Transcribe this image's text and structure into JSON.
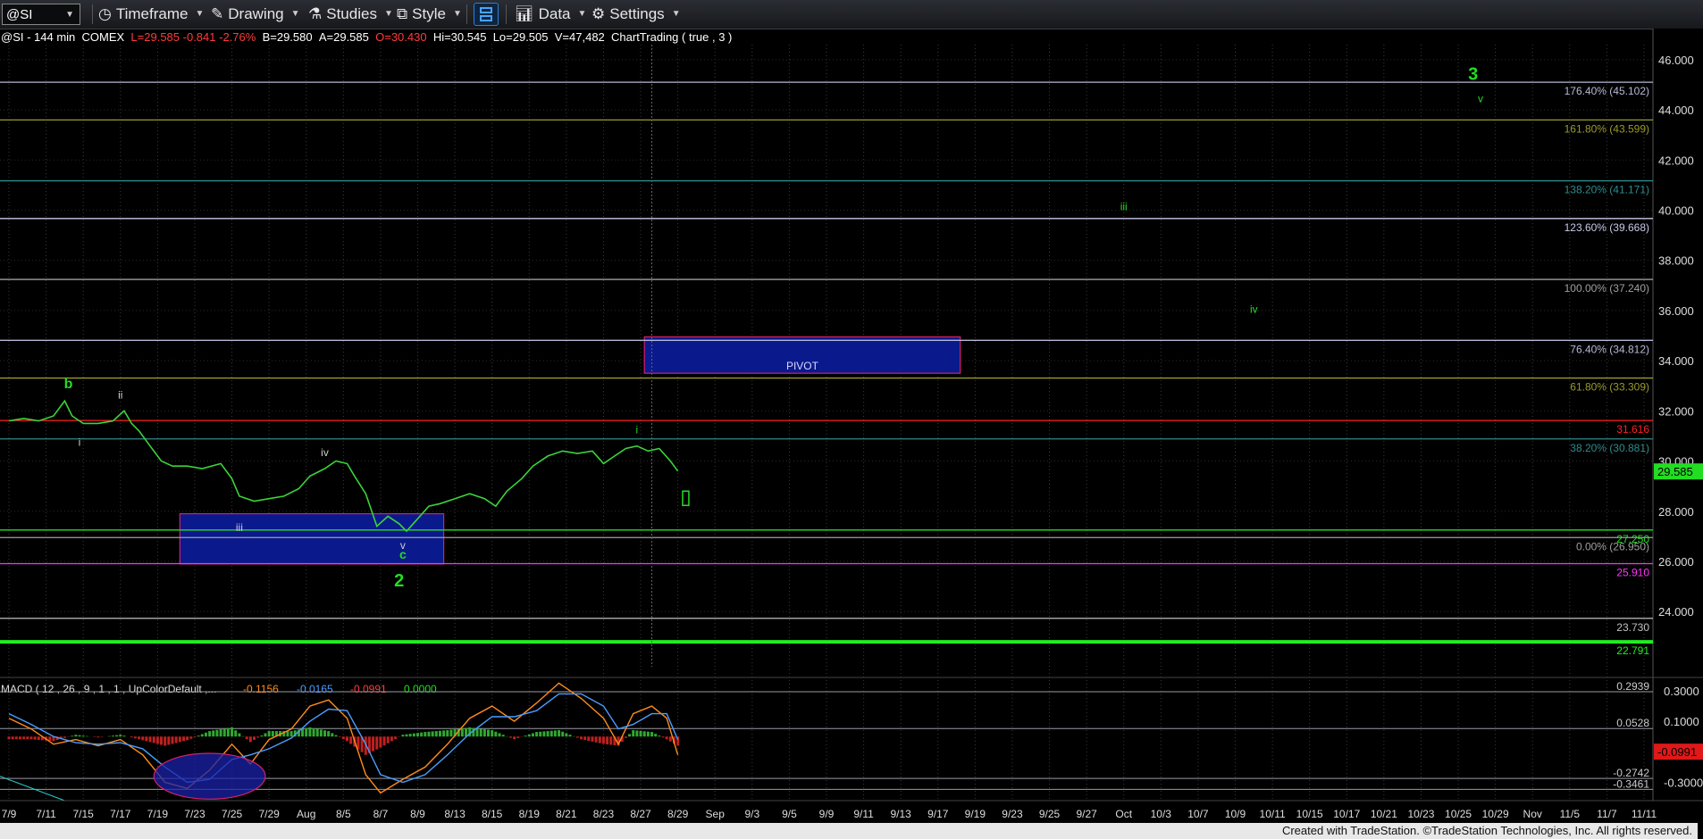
{
  "toolbar": {
    "symbol": "@SI",
    "items": [
      {
        "label": "Timeframe",
        "icon": "clock-icon"
      },
      {
        "label": "Drawing",
        "icon": "pencil-icon"
      },
      {
        "label": "Studies",
        "icon": "flask-icon"
      },
      {
        "label": "Style",
        "icon": "style-icon"
      },
      {
        "label": "Data",
        "icon": "bar-chart-icon"
      },
      {
        "label": "Settings",
        "icon": "gear-icon"
      }
    ]
  },
  "info": {
    "symbol": "@SI - 144 min",
    "exchange": "COMEX",
    "last": "L=29.585",
    "change": "-0.841",
    "pct": "-2.76%",
    "bid": "B=29.580",
    "ask": "A=29.585",
    "open": "O=30.430",
    "high": "Hi=30.545",
    "low": "Lo=29.505",
    "volume": "V=47,482",
    "study": "ChartTrading ( true , 3 )"
  },
  "credit": "Created with TradeStation. ©TradeStation Technologies, Inc. All rights reserved.",
  "chart_data": {
    "type": "line",
    "price_axis": {
      "ylim": [
        21.8,
        46.6
      ],
      "ticks": [
        {
          "v": 46,
          "label": "46.000"
        },
        {
          "v": 44,
          "label": "44.000"
        },
        {
          "v": 42,
          "label": "42.000"
        },
        {
          "v": 40,
          "label": "40.000"
        },
        {
          "v": 38,
          "label": "38.000"
        },
        {
          "v": 36,
          "label": "36.000"
        },
        {
          "v": 34,
          "label": "34.000"
        },
        {
          "v": 32,
          "label": "32.000"
        },
        {
          "v": 30,
          "label": "30.000"
        },
        {
          "v": 28,
          "label": "28.000"
        },
        {
          "v": 26,
          "label": "26.000"
        },
        {
          "v": 24,
          "label": "24.000"
        }
      ],
      "last_price": {
        "label": "29.585",
        "v": 29.585,
        "color": "#22dd22"
      }
    },
    "x_axis": {
      "labels": [
        "7/9",
        "7/11",
        "7/15",
        "7/17",
        "7/19",
        "7/23",
        "7/25",
        "7/29",
        "Aug",
        "8/5",
        "8/7",
        "8/9",
        "8/13",
        "8/15",
        "8/19",
        "8/21",
        "8/23",
        "8/27",
        "8/29",
        "Sep",
        "9/3",
        "9/5",
        "9/9",
        "9/11",
        "9/13",
        "9/17",
        "9/19",
        "9/23",
        "9/25",
        "9/27",
        "Oct",
        "10/3",
        "10/7",
        "10/9",
        "10/11",
        "10/15",
        "10/17",
        "10/21",
        "10/23",
        "10/25",
        "10/29",
        "Nov",
        "11/5",
        "11/7",
        "11/11"
      ],
      "last_bar_index": 18
    },
    "levels": [
      {
        "label": "176.40% (45.102)",
        "v": 45.102,
        "color": "#b8b8d8",
        "style": "solid"
      },
      {
        "label": "161.80% (43.599)",
        "v": 43.599,
        "color": "#9a9a2a",
        "style": "solid"
      },
      {
        "label": "138.20% (41.171)",
        "v": 41.171,
        "color": "#2e8b8b",
        "style": "solid"
      },
      {
        "label": "123.60% (39.668)",
        "v": 39.668,
        "color": "#c8c8e8",
        "style": "solid"
      },
      {
        "label": "100.00% (37.240)",
        "v": 37.24,
        "color": "#a0a0a0",
        "style": "solid"
      },
      {
        "label": "76.40% (34.812)",
        "v": 34.812,
        "color": "#b8b8d8",
        "style": "solid"
      },
      {
        "label": "61.80% (33.309)",
        "v": 33.309,
        "color": "#9a9a2a",
        "style": "solid"
      },
      {
        "label": "31.616",
        "v": 31.616,
        "color": "#ff2020",
        "style": "solid"
      },
      {
        "label": "38.20% (30.881)",
        "v": 30.881,
        "color": "#2e8b8b",
        "style": "solid"
      },
      {
        "label": "27.250",
        "v": 27.25,
        "color": "#22dd22",
        "style": "solid"
      },
      {
        "label": "0.00% (26.950)",
        "v": 26.95,
        "color": "#a0a0a0",
        "style": "solid"
      },
      {
        "label": "25.910",
        "v": 25.91,
        "color": "#ff33ff",
        "style": "solid"
      },
      {
        "label": "23.730",
        "v": 23.73,
        "color": "#c0c0c0",
        "style": "solid"
      },
      {
        "label": "22.791",
        "v": 22.791,
        "color": "#22ee22",
        "style": "thick"
      }
    ],
    "boxes": [
      {
        "label": "PIVOT",
        "x0": 17.1,
        "x1": 25.6,
        "y0": 33.5,
        "y1": 34.95
      },
      {
        "label": "",
        "x0": 4.6,
        "x1": 11.7,
        "y0": 25.9,
        "y1": 27.9
      }
    ],
    "wave_labels": [
      {
        "text": "b",
        "x": 1.6,
        "y": 32.9,
        "color": "#22dd22",
        "size": 16
      },
      {
        "text": "i",
        "x": 1.9,
        "y": 30.6,
        "color": "#cccccc",
        "size": 12
      },
      {
        "text": "ii",
        "x": 3.0,
        "y": 32.5,
        "color": "#cccccc",
        "size": 12
      },
      {
        "text": "iii",
        "x": 6.2,
        "y": 27.2,
        "color": "#cccccc",
        "size": 12
      },
      {
        "text": "iv",
        "x": 8.5,
        "y": 30.2,
        "color": "#cccccc",
        "size": 12
      },
      {
        "text": "v",
        "x": 10.6,
        "y": 26.5,
        "color": "#cccccc",
        "size": 12
      },
      {
        "text": "c",
        "x": 10.6,
        "y": 26.1,
        "color": "#22dd22",
        "size": 14
      },
      {
        "text": "2",
        "x": 10.5,
        "y": 25.0,
        "color": "#22dd22",
        "size": 20
      },
      {
        "text": "i",
        "x": 16.9,
        "y": 31.1,
        "color": "#22dd22",
        "size": 12
      },
      {
        "text": "iii",
        "x": 30.0,
        "y": 40.0,
        "color": "#22dd22",
        "size": 12
      },
      {
        "text": "iv",
        "x": 33.5,
        "y": 35.9,
        "color": "#22dd22",
        "size": 12
      },
      {
        "text": "3",
        "x": 39.4,
        "y": 45.2,
        "color": "#22dd22",
        "size": 20
      },
      {
        "text": "v",
        "x": 39.6,
        "y": 44.3,
        "color": "#22dd22",
        "size": 12
      }
    ],
    "price_series": {
      "name": "@SI",
      "points": [
        [
          0,
          31.6
        ],
        [
          0.4,
          31.7
        ],
        [
          0.8,
          31.6
        ],
        [
          1.2,
          31.8
        ],
        [
          1.5,
          32.4
        ],
        [
          1.7,
          31.8
        ],
        [
          2.0,
          31.5
        ],
        [
          2.4,
          31.5
        ],
        [
          2.8,
          31.6
        ],
        [
          3.1,
          32.0
        ],
        [
          3.3,
          31.5
        ],
        [
          3.5,
          31.2
        ],
        [
          3.8,
          30.6
        ],
        [
          4.1,
          30.0
        ],
        [
          4.4,
          29.8
        ],
        [
          4.8,
          29.8
        ],
        [
          5.2,
          29.7
        ],
        [
          5.7,
          29.9
        ],
        [
          6.0,
          29.3
        ],
        [
          6.2,
          28.6
        ],
        [
          6.6,
          28.4
        ],
        [
          7.0,
          28.5
        ],
        [
          7.4,
          28.6
        ],
        [
          7.8,
          28.9
        ],
        [
          8.1,
          29.4
        ],
        [
          8.5,
          29.7
        ],
        [
          8.8,
          30.0
        ],
        [
          9.1,
          29.9
        ],
        [
          9.3,
          29.4
        ],
        [
          9.6,
          28.7
        ],
        [
          9.9,
          27.4
        ],
        [
          10.2,
          27.8
        ],
        [
          10.5,
          27.5
        ],
        [
          10.7,
          27.2
        ],
        [
          11.0,
          27.7
        ],
        [
          11.3,
          28.2
        ],
        [
          11.6,
          28.3
        ],
        [
          12.0,
          28.5
        ],
        [
          12.4,
          28.7
        ],
        [
          12.8,
          28.5
        ],
        [
          13.1,
          28.2
        ],
        [
          13.4,
          28.8
        ],
        [
          13.8,
          29.3
        ],
        [
          14.1,
          29.8
        ],
        [
          14.5,
          30.2
        ],
        [
          14.9,
          30.4
        ],
        [
          15.3,
          30.3
        ],
        [
          15.7,
          30.4
        ],
        [
          16.0,
          29.9
        ],
        [
          16.3,
          30.2
        ],
        [
          16.6,
          30.5
        ],
        [
          16.9,
          30.6
        ],
        [
          17.2,
          30.4
        ],
        [
          17.5,
          30.5
        ],
        [
          17.8,
          30.0
        ],
        [
          18.0,
          29.6
        ]
      ]
    },
    "macd": {
      "label": "MACD ( 12 , 26 , 9 , 1 , 1 , UpColorDefault ,...",
      "values": [
        "-0.1156",
        "-0.0165",
        "-0.0991",
        "0.0000"
      ],
      "value_colors": [
        "#ff8c1a",
        "#4a9eff",
        "#ff3b3b",
        "#22dd22"
      ],
      "ylim": [
        -0.42,
        0.37
      ],
      "ticks": [
        {
          "v": 0.3,
          "label": "0.3000"
        },
        {
          "v": 0.1,
          "label": "0.1000"
        },
        {
          "v": -0.3,
          "label": "-0.3000"
        }
      ],
      "levels": [
        {
          "v": 0.2939,
          "label": "0.2939"
        },
        {
          "v": 0.0528,
          "label": "0.0528"
        },
        {
          "v": -0.2742,
          "label": "-0.2742"
        },
        {
          "v": -0.3461,
          "label": "-0.3461"
        }
      ],
      "current": {
        "v": -0.0991,
        "label": "-0.0991"
      },
      "macd_line": [
        [
          0,
          0.12
        ],
        [
          0.6,
          0.05
        ],
        [
          1.2,
          -0.05
        ],
        [
          1.8,
          -0.02
        ],
        [
          2.4,
          -0.06
        ],
        [
          3.0,
          -0.02
        ],
        [
          3.6,
          -0.12
        ],
        [
          4.2,
          -0.3
        ],
        [
          4.8,
          -0.34
        ],
        [
          5.4,
          -0.22
        ],
        [
          6.0,
          -0.05
        ],
        [
          6.5,
          -0.18
        ],
        [
          7.0,
          -0.02
        ],
        [
          7.6,
          0.05
        ],
        [
          8.1,
          0.2
        ],
        [
          8.6,
          0.24
        ],
        [
          9.1,
          0.12
        ],
        [
          9.6,
          -0.25
        ],
        [
          10.0,
          -0.37
        ],
        [
          10.6,
          -0.28
        ],
        [
          11.2,
          -0.2
        ],
        [
          11.8,
          -0.05
        ],
        [
          12.4,
          0.12
        ],
        [
          13.0,
          0.2
        ],
        [
          13.6,
          0.1
        ],
        [
          14.2,
          0.22
        ],
        [
          14.8,
          0.35
        ],
        [
          15.4,
          0.25
        ],
        [
          16.0,
          0.12
        ],
        [
          16.4,
          -0.05
        ],
        [
          16.8,
          0.15
        ],
        [
          17.3,
          0.2
        ],
        [
          17.7,
          0.12
        ],
        [
          18.0,
          -0.12
        ]
      ],
      "signal_line": [
        [
          0,
          0.15
        ],
        [
          0.6,
          0.08
        ],
        [
          1.2,
          0.0
        ],
        [
          1.8,
          -0.04
        ],
        [
          2.4,
          -0.05
        ],
        [
          3.0,
          -0.04
        ],
        [
          3.6,
          -0.08
        ],
        [
          4.2,
          -0.2
        ],
        [
          4.8,
          -0.3
        ],
        [
          5.4,
          -0.28
        ],
        [
          6.0,
          -0.15
        ],
        [
          6.5,
          -0.12
        ],
        [
          7.0,
          -0.08
        ],
        [
          7.6,
          -0.01
        ],
        [
          8.1,
          0.1
        ],
        [
          8.6,
          0.18
        ],
        [
          9.1,
          0.17
        ],
        [
          9.6,
          -0.05
        ],
        [
          10.0,
          -0.25
        ],
        [
          10.6,
          -0.3
        ],
        [
          11.2,
          -0.25
        ],
        [
          11.8,
          -0.12
        ],
        [
          12.4,
          0.02
        ],
        [
          13.0,
          0.13
        ],
        [
          13.6,
          0.13
        ],
        [
          14.2,
          0.17
        ],
        [
          14.8,
          0.28
        ],
        [
          15.4,
          0.28
        ],
        [
          16.0,
          0.2
        ],
        [
          16.4,
          0.05
        ],
        [
          16.8,
          0.08
        ],
        [
          17.3,
          0.15
        ],
        [
          17.7,
          0.15
        ],
        [
          18.0,
          -0.02
        ]
      ],
      "ellipse": {
        "cx": 5.4,
        "cy": -0.26,
        "rx": 1.5,
        "ry": 0.15
      }
    }
  }
}
